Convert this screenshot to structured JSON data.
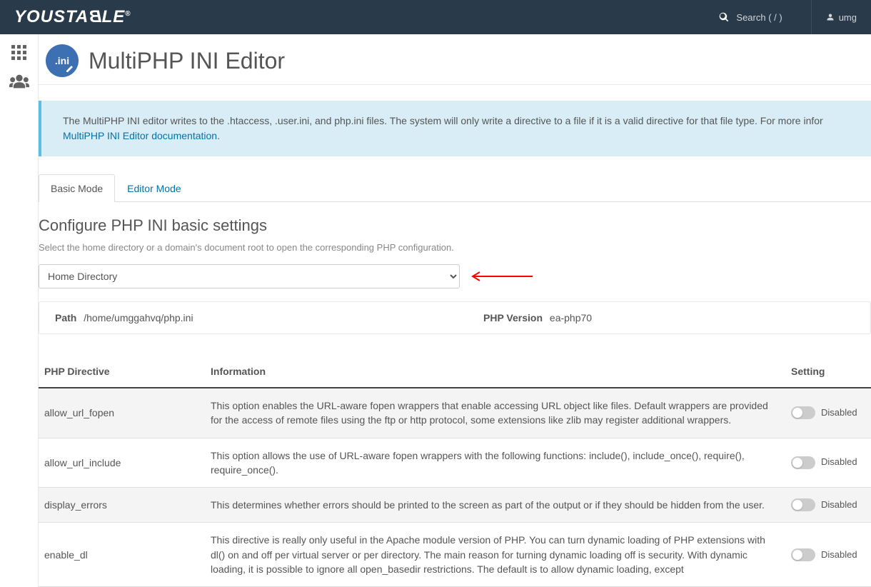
{
  "header": {
    "brand": "YOUSTABLE",
    "search_placeholder": "Search ( / )",
    "user": "umg"
  },
  "page": {
    "title": "MultiPHP INI Editor",
    "info_text": "The MultiPHP INI editor writes to the .htaccess, .user.ini, and php.ini files. The system will only write a directive to a file if it is a valid directive for that file type. For more infor",
    "info_link": "MultiPHP INI Editor documentation",
    "tabs": {
      "basic": "Basic Mode",
      "editor": "Editor Mode"
    },
    "section_title": "Configure PHP INI basic settings",
    "section_desc": "Select the home directory or a domain's document root to open the corresponding PHP configuration.",
    "domain_selected": "Home Directory",
    "path_label": "Path",
    "path_value": "/home/umggahvq/php.ini",
    "version_label": "PHP Version",
    "version_value": "ea-php70",
    "table_headers": {
      "directive": "PHP Directive",
      "info": "Information",
      "setting": "Setting"
    },
    "disabled_label": "Disabled",
    "rows": [
      {
        "name": "allow_url_fopen",
        "info": "This option enables the URL-aware fopen wrappers that enable accessing URL object like files. Default wrappers are provided for the access of remote files using the ftp or http protocol, some extensions like zlib may register additional wrappers."
      },
      {
        "name": "allow_url_include",
        "info": "This option allows the use of URL-aware fopen wrappers with the following functions: include(), include_once(), require(), require_once()."
      },
      {
        "name": "display_errors",
        "info": "This determines whether errors should be printed to the screen as part of the output or if they should be hidden from the user."
      },
      {
        "name": "enable_dl",
        "info": "This directive is really only useful in the Apache module version of PHP. You can turn dynamic loading of PHP extensions with dl() on and off per virtual server or per directory. The main reason for turning dynamic loading off is security. With dynamic loading, it is possible to ignore all open_basedir restrictions. The default is to allow dynamic loading, except"
      }
    ]
  }
}
